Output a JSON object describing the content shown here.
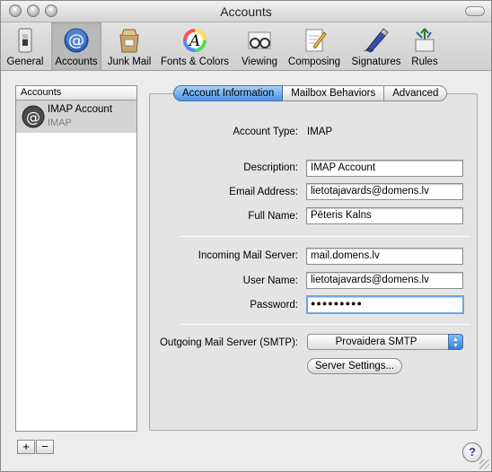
{
  "window": {
    "title": "Accounts"
  },
  "toolbar": {
    "items": [
      {
        "label": "General",
        "icon": "light-switch-icon",
        "selected": false
      },
      {
        "label": "Accounts",
        "icon": "at-sign-icon",
        "selected": true
      },
      {
        "label": "Junk Mail",
        "icon": "junk-mail-bag-icon",
        "selected": false
      },
      {
        "label": "Fonts & Colors",
        "icon": "font-color-wheel-icon",
        "selected": false
      },
      {
        "label": "Viewing",
        "icon": "glasses-icon",
        "selected": false
      },
      {
        "label": "Composing",
        "icon": "notepad-pencil-icon",
        "selected": false
      },
      {
        "label": "Signatures",
        "icon": "fountain-pen-icon",
        "selected": false
      },
      {
        "label": "Rules",
        "icon": "rules-arrows-icon",
        "selected": false
      }
    ]
  },
  "sidebar": {
    "header": "Accounts",
    "accounts": [
      {
        "name": "IMAP Account",
        "type": "IMAP",
        "icon": "at-sign-icon"
      }
    ],
    "add_label": "+",
    "remove_label": "−"
  },
  "tabs": [
    {
      "label": "Account Information",
      "active": true
    },
    {
      "label": "Mailbox Behaviors",
      "active": false
    },
    {
      "label": "Advanced",
      "active": false
    }
  ],
  "form": {
    "account_type_label": "Account Type:",
    "account_type_value": "IMAP",
    "description_label": "Description:",
    "description_value": "IMAP Account",
    "email_label": "Email Address:",
    "email_value": "lietotajavards@domens.lv",
    "fullname_label": "Full Name:",
    "fullname_value": "Pēteris Kalns",
    "incoming_label": "Incoming Mail Server:",
    "incoming_value": "mail.domens.lv",
    "username_label": "User Name:",
    "username_value": "lietotajavards@domens.lv",
    "password_label": "Password:",
    "password_value": "●●●●●●●●●",
    "outgoing_label": "Outgoing Mail Server (SMTP):",
    "outgoing_value": "Provaidera SMTP",
    "server_settings_label": "Server Settings..."
  },
  "help_label": "?",
  "colors": {
    "tab_active": "#4a94e6",
    "focus_ring": "#6da6e4",
    "selected_row": "#d4d4d4"
  }
}
